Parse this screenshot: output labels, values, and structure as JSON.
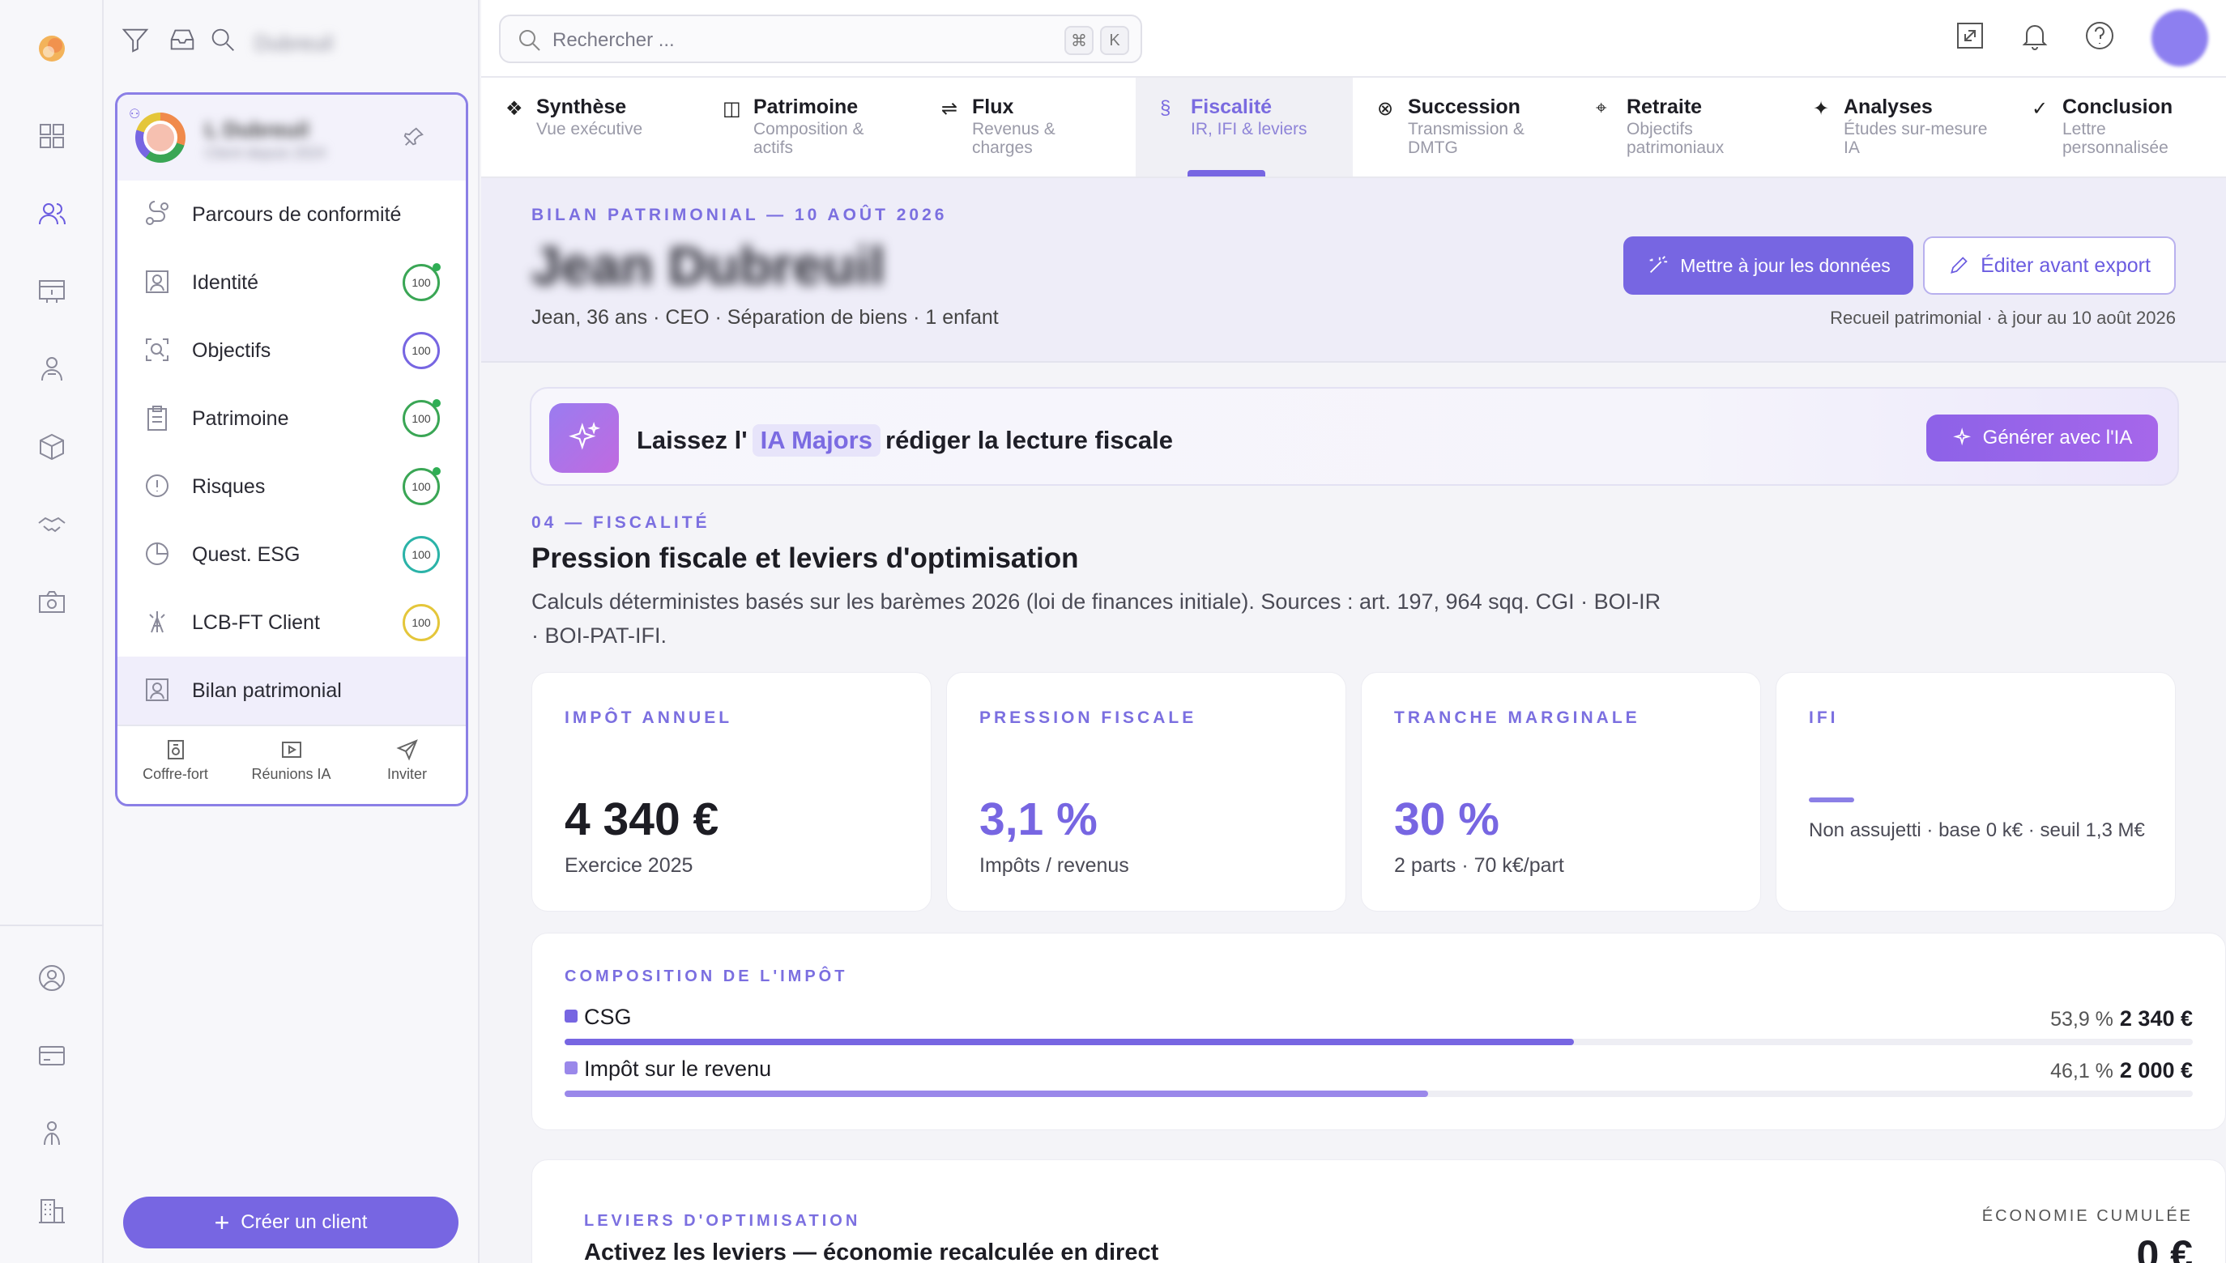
{
  "panel": {
    "client_name": "L Dubreuil",
    "client_sub": "Client depuis 2024",
    "search_label": "Dubreuil",
    "items": [
      {
        "label": "Parcours de conformité",
        "score": null,
        "color": ""
      },
      {
        "label": "Identité",
        "score": "100",
        "color": "#3aa655",
        "dot": true
      },
      {
        "label": "Objectifs",
        "score": "100",
        "color": "#7766e2",
        "dot": false
      },
      {
        "label": "Patrimoine",
        "score": "100",
        "color": "#3aa655",
        "dot": true
      },
      {
        "label": "Risques",
        "score": "100",
        "color": "#3aa655",
        "dot": true
      },
      {
        "label": "Quest. ESG",
        "score": "100",
        "color": "#2bb3a8",
        "dot": false
      },
      {
        "label": "LCB-FT Client",
        "score": "100",
        "color": "#e4c63a",
        "dot": false
      },
      {
        "label": "Bilan patrimonial",
        "score": null,
        "color": ""
      }
    ],
    "footer": [
      {
        "label": "Coffre-fort",
        "icon": "safe-icon"
      },
      {
        "label": "Réunions IA",
        "icon": "video-icon"
      },
      {
        "label": "Inviter",
        "icon": "send-icon"
      }
    ],
    "create_label": "Créer un client"
  },
  "topbar": {
    "search_placeholder": "Rechercher ...",
    "kbd1": "⌘",
    "kbd2": "K"
  },
  "tabs": [
    {
      "icon": "❖",
      "title": "Synthèse",
      "sub": "Vue exécutive"
    },
    {
      "icon": "◫",
      "title": "Patrimoine",
      "sub": "Composition & actifs"
    },
    {
      "icon": "⇌",
      "title": "Flux",
      "sub": "Revenus & charges"
    },
    {
      "icon": "§",
      "title": "Fiscalité",
      "sub": "IR, IFI & leviers"
    },
    {
      "icon": "⊗",
      "title": "Succession",
      "sub": "Transmission & DMTG"
    },
    {
      "icon": "⌖",
      "title": "Retraite",
      "sub": "Objectifs patrimoniaux"
    },
    {
      "icon": "✦",
      "title": "Analyses",
      "sub": "Études sur-mesure IA"
    },
    {
      "icon": "✓",
      "title": "Conclusion",
      "sub": "Lettre personnalisée"
    }
  ],
  "hero": {
    "eyebrow": "BILAN PATRIMONIAL — 10 AOÛT 2026",
    "name": "Jean Dubreuil",
    "sub": "Jean, 36 ans · CEO · Séparation de biens · 1 enfant",
    "btn_update": "Mettre à jour les données",
    "btn_edit": "Éditer avant export",
    "note": "Recueil patrimonial · à jour au 10 août 2026"
  },
  "ia": {
    "prefix": "Laissez l'",
    "tag": "IA Majors",
    "suffix": "rédiger la lecture fiscale",
    "button": "Générer avec l'IA"
  },
  "section": {
    "eyebrow": "04 — FISCALITÉ",
    "title": "Pression fiscale et leviers d'optimisation",
    "desc": "Calculs déterministes basés sur les barèmes 2026 (loi de finances initiale). Sources : art. 197, 964 sqq. CGI · BOI-IR · BOI-PAT-IFI."
  },
  "kpis": [
    {
      "label": "IMPÔT ANNUEL",
      "value": "4 340 €",
      "sub": "Exercice 2025"
    },
    {
      "label": "PRESSION FISCALE",
      "value": "3,1 %",
      "sub": "Impôts / revenus"
    },
    {
      "label": "TRANCHE MARGINALE",
      "value": "30 %",
      "sub": "2 parts · 70 k€/part"
    },
    {
      "label": "IFI",
      "value": "",
      "sub": "Non assujetti · base 0 k€ · seuil 1,3 M€"
    }
  ],
  "composition": {
    "title": "COMPOSITION DE L'IMPÔT",
    "rows": [
      {
        "label": "CSG",
        "pct": "53,9 %",
        "amount": "2 340 €",
        "share": 0.539,
        "color": "#7766e2"
      },
      {
        "label": "Impôt sur le revenu",
        "pct": "46,1 %",
        "amount": "2 000 €",
        "share": 0.461,
        "color": "#9a88ea"
      }
    ]
  },
  "levers": {
    "eyebrow": "LEVIERS D'OPTIMISATION",
    "title": "Activez les leviers — économie recalculée en direct",
    "savings_label": "ÉCONOMIE CUMULÉE",
    "savings_value": "0 €"
  },
  "colors": {
    "accent": "#7766e2",
    "accent_light": "#eeedf8"
  }
}
